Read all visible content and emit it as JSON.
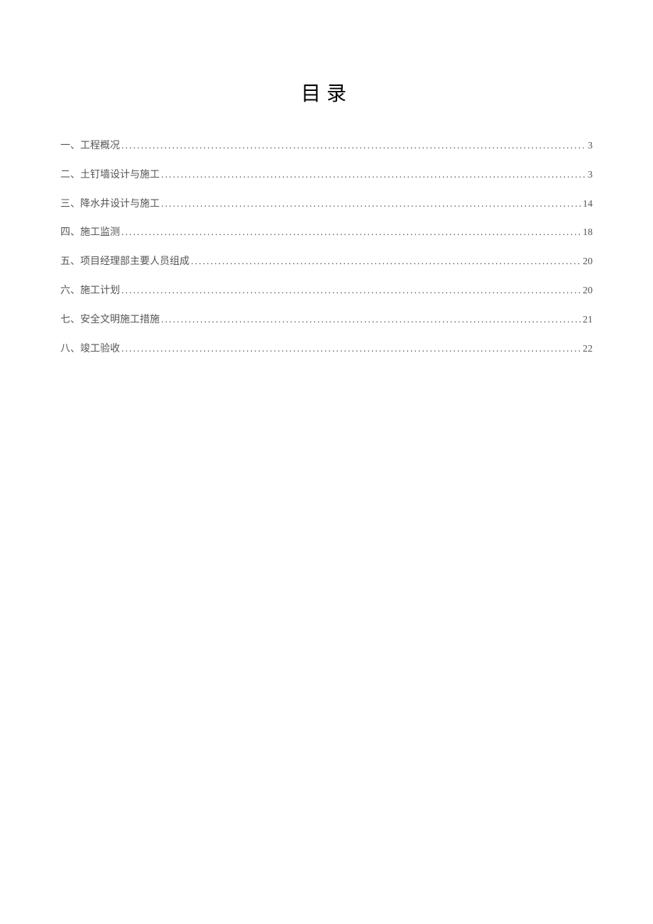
{
  "title": "目录",
  "toc": [
    {
      "label": "一、工程概况",
      "page": "3"
    },
    {
      "label": "二、土钉墙设计与施工",
      "page": "3"
    },
    {
      "label": "三、降水井设计与施工",
      "page": "14"
    },
    {
      "label": "四、施工监测",
      "page": "18"
    },
    {
      "label": "五、项目经理部主要人员组成",
      "page": "20"
    },
    {
      "label": "六、施工计划",
      "page": "20"
    },
    {
      "label": "七、安全文明施工措施",
      "page": "21"
    },
    {
      "label": "八、竣工验收",
      "page": "22"
    }
  ]
}
